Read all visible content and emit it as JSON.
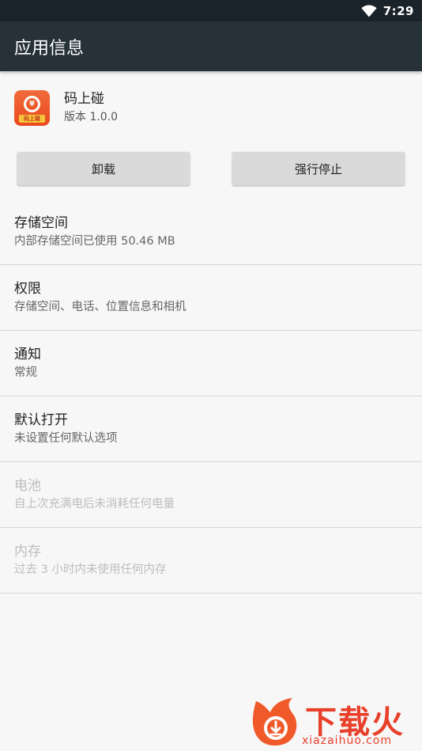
{
  "status_bar": {
    "time": "7:29",
    "icons": [
      "wifi-icon"
    ]
  },
  "app_bar": {
    "title": "应用信息"
  },
  "app": {
    "name": "码上碰",
    "version": "版本 1.0.0",
    "icon_symbol": "¥",
    "icon_band_text": "码上碰"
  },
  "buttons": {
    "uninstall": "卸载",
    "force_stop": "强行停止"
  },
  "settings": [
    {
      "title": "存储空间",
      "summary": "内部存储空间已使用 50.46 MB",
      "enabled": true
    },
    {
      "title": "权限",
      "summary": "存储空间、电话、位置信息和相机",
      "enabled": true
    },
    {
      "title": "通知",
      "summary": "常规",
      "enabled": true
    },
    {
      "title": "默认打开",
      "summary": "未设置任何默认选项",
      "enabled": true
    },
    {
      "title": "电池",
      "summary": "自上次充满电后未消耗任何电量",
      "enabled": false
    },
    {
      "title": "内存",
      "summary": "过去 3 小时内未使用任何内存",
      "enabled": false
    }
  ],
  "watermark": {
    "brand": "下载火",
    "domain": "xiazaihuo.com"
  },
  "colors": {
    "status_bar": "#1a2329",
    "app_bar": "#263238",
    "background": "#f7f7f7",
    "button": "#dadada",
    "watermark": "#e8402a"
  }
}
